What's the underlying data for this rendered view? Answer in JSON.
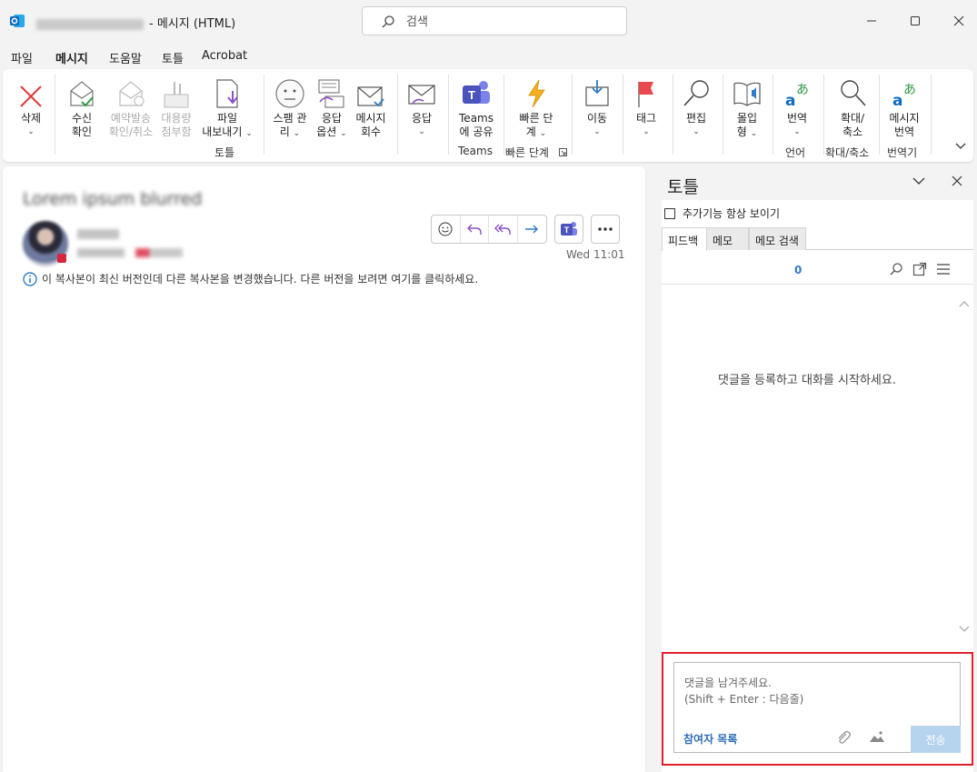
{
  "window": {
    "title": "- 메시지 (HTML)",
    "search_placeholder": "검색"
  },
  "menu": {
    "tabs": [
      "파일",
      "메시지",
      "도움말",
      "토틀",
      "Acrobat"
    ],
    "active": "메시지"
  },
  "ribbon": {
    "delete": [
      "삭제",
      ""
    ],
    "read_receipt": [
      "수신",
      "확인"
    ],
    "schedule_cancel": [
      "예약발송",
      "확인/취소"
    ],
    "large_attach": [
      "대용량",
      "첨부함"
    ],
    "file_export": [
      "파일",
      "내보내기"
    ],
    "spam": [
      "스팸 관",
      "리"
    ],
    "reply_options": [
      "응답",
      "옵션"
    ],
    "recall": [
      "메시지",
      "회수"
    ],
    "respond": [
      "응답",
      ""
    ],
    "teams_share": [
      "Teams",
      "에 공유"
    ],
    "quick_steps": [
      "빠른 단",
      "계"
    ],
    "move": [
      "이동",
      ""
    ],
    "tags": [
      "태그",
      ""
    ],
    "editing": [
      "편집",
      ""
    ],
    "immersive": [
      "몰입",
      "형"
    ],
    "translate": [
      "번역",
      ""
    ],
    "zoom": [
      "확대/",
      "축소"
    ],
    "message_translate": [
      "메시지",
      "번역"
    ],
    "group_labels": {
      "totle": "토틀",
      "teams": "Teams",
      "quick_steps": "빠른 단계",
      "language": "언어",
      "zoom": "확대/축소",
      "translator": "번역기"
    }
  },
  "mail": {
    "time": "Wed 11:01",
    "info": "이 복사본이 최신 버전인데 다른 복사본을 변경했습니다. 다른 버전을 보려면 여기를 클릭하세요."
  },
  "pane": {
    "title": "토틀",
    "always_show": "추가기능 항상 보이기",
    "tabs": [
      "피드백",
      "메모",
      "메모 검색"
    ],
    "count": "0",
    "empty_message": "댓글을 등록하고 대화를 시작하세요.",
    "composer_placeholder1": "댓글을 남겨주세요.",
    "composer_placeholder2": "(Shift + Enter : 다음줄)",
    "participants": "참여자 목록",
    "send": "전송"
  }
}
